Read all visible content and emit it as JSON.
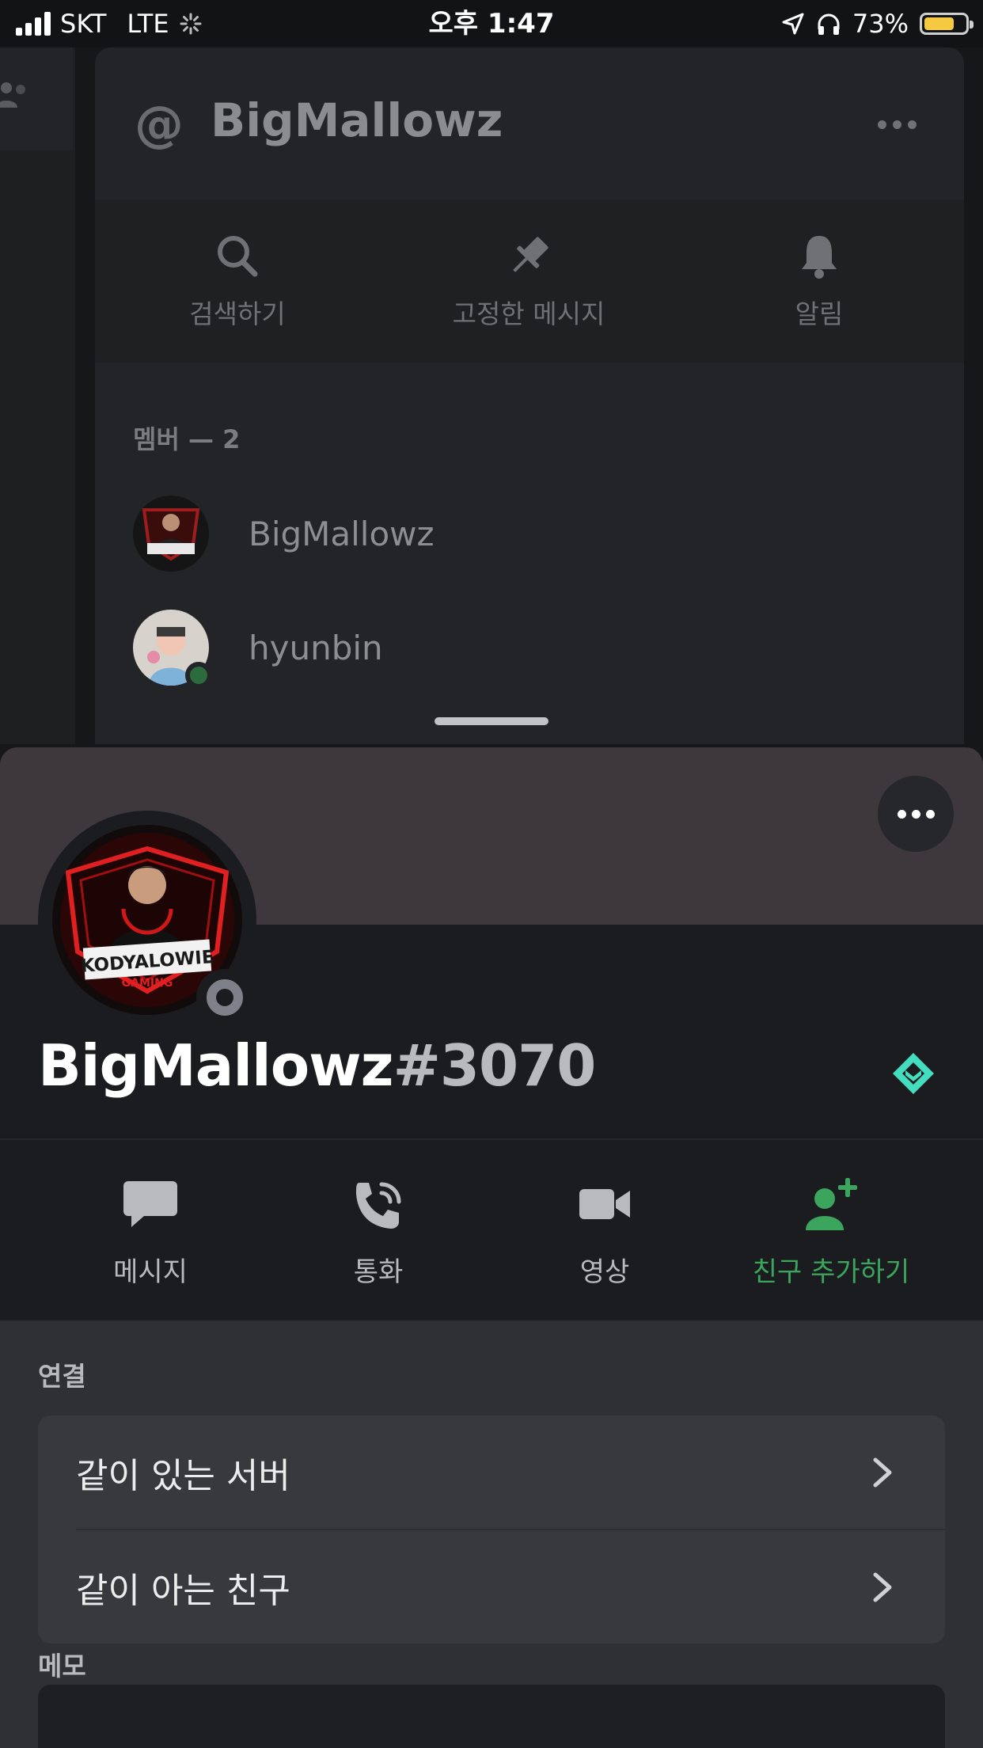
{
  "status_bar": {
    "carrier": "SKT",
    "network": "LTE",
    "time": "오후 1:47",
    "battery_percent": "73%",
    "battery_level": 0.73,
    "battery_color": "#f6c943"
  },
  "background_panel": {
    "channel_prefix": "@",
    "title": "BigMallowz",
    "actions": [
      {
        "label": "검색하기",
        "icon": "search-icon"
      },
      {
        "label": "고정한 메시지",
        "icon": "pin-icon"
      },
      {
        "label": "알림",
        "icon": "bell-icon"
      }
    ],
    "members_title": "멤버 — 2",
    "members": [
      {
        "name": "BigMallowz",
        "status": "offline"
      },
      {
        "name": "hyunbin",
        "status": "online"
      }
    ]
  },
  "profile": {
    "username": "BigMallowz",
    "discriminator": "#3070",
    "banner_color": "#3e383c",
    "status": "offline",
    "badge_icon": "hypesquad-badge-icon",
    "avatar_text": "KODYALOWIE",
    "avatar_subtext": "GAMING"
  },
  "profile_actions": [
    {
      "label": "메시지",
      "icon": "chat-bubble-icon"
    },
    {
      "label": "통화",
      "icon": "phone-call-icon"
    },
    {
      "label": "영상",
      "icon": "video-camera-icon"
    },
    {
      "label": "친구 추가하기",
      "icon": "add-friend-icon",
      "color": "#3ba55d"
    }
  ],
  "connections": {
    "title": "연결",
    "rows": [
      {
        "label": "같이 있는 서버"
      },
      {
        "label": "같이 아는 친구"
      }
    ]
  },
  "memo": {
    "title": "메모"
  }
}
